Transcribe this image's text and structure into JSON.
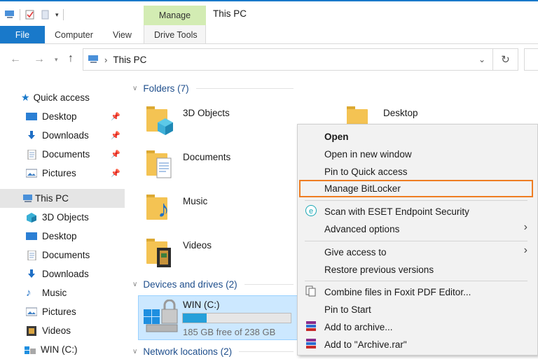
{
  "window": {
    "title": "This PC"
  },
  "ribbon": {
    "file": "File",
    "tabs": [
      "Computer",
      "View"
    ],
    "context_group": "Manage",
    "context_tab": "Drive Tools"
  },
  "address": {
    "crumb": "This PC",
    "separator": "›"
  },
  "nav": {
    "quick_access": "Quick access",
    "quick_items": [
      "Desktop",
      "Downloads",
      "Documents",
      "Pictures"
    ],
    "this_pc": "This PC",
    "pc_items": [
      "3D Objects",
      "Desktop",
      "Documents",
      "Downloads",
      "Music",
      "Pictures",
      "Videos",
      "WIN (C:)"
    ]
  },
  "content": {
    "folders_header": "Folders (7)",
    "folders": [
      "3D Objects",
      "Desktop",
      "Documents",
      "Music",
      "Videos"
    ],
    "devices_header": "Devices and drives (2)",
    "drive": {
      "name": "WIN (C:)",
      "free_text": "185 GB free of 238 GB",
      "used_fraction": 0.22
    },
    "network_header": "Network locations (2)"
  },
  "context_menu": {
    "open": "Open",
    "open_new": "Open in new window",
    "pin_quick": "Pin to Quick access",
    "bitlocker": "Manage BitLocker",
    "eset": "Scan with ESET Endpoint Security",
    "advanced": "Advanced options",
    "give_access": "Give access to",
    "restore": "Restore previous versions",
    "foxit": "Combine files in Foxit PDF Editor...",
    "pin_start": "Pin to Start",
    "add_archive": "Add to archive...",
    "add_rar": "Add to \"Archive.rar\""
  },
  "colors": {
    "accent": "#1979ca",
    "highlight": "#ee7d22",
    "manage_bg": "#d3ecb3",
    "drive_selected": "#cce8ff"
  }
}
